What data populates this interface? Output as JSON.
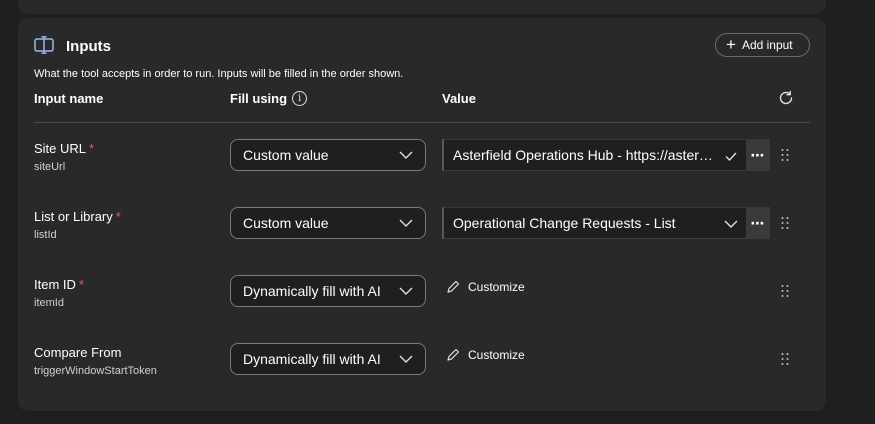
{
  "section": {
    "title": "Inputs",
    "subtitle": "What the tool accepts in order to run. Inputs will be filled in the order shown.",
    "add_button_label": "Add input",
    "columns": {
      "name": "Input name",
      "fill": "Fill using",
      "value": "Value"
    }
  },
  "rows": [
    {
      "label": "Site URL",
      "required": "*",
      "sub": "siteUrl",
      "fill": "Custom value",
      "value": "Asterfield Operations Hub - https://asterf...",
      "value_icon": "check-icon",
      "customize": ""
    },
    {
      "label": "List or Library",
      "required": "*",
      "sub": "listId",
      "fill": "Custom value",
      "value": "Operational Change Requests - List",
      "value_icon": "chevron-down-icon",
      "customize": ""
    },
    {
      "label": "Item ID",
      "required": "*",
      "sub": "itemId",
      "fill": "Dynamically fill with AI",
      "value": "",
      "customize": "Customize"
    },
    {
      "label": "Compare From",
      "required": "",
      "sub": "triggerWindowStartToken",
      "fill": "Dynamically fill with AI",
      "value": "",
      "customize": "Customize"
    }
  ],
  "icons": {
    "header": "input-icon",
    "add": "plus-icon",
    "info": "info-icon",
    "refresh": "refresh-icon",
    "more": "more-icon",
    "edit": "pencil-icon",
    "drag": "drag-handle-icon"
  },
  "colors": {
    "background": "#1f1f1f",
    "card": "#292929",
    "required": "#e05a62",
    "accent_icon": "#9ab7e8"
  }
}
